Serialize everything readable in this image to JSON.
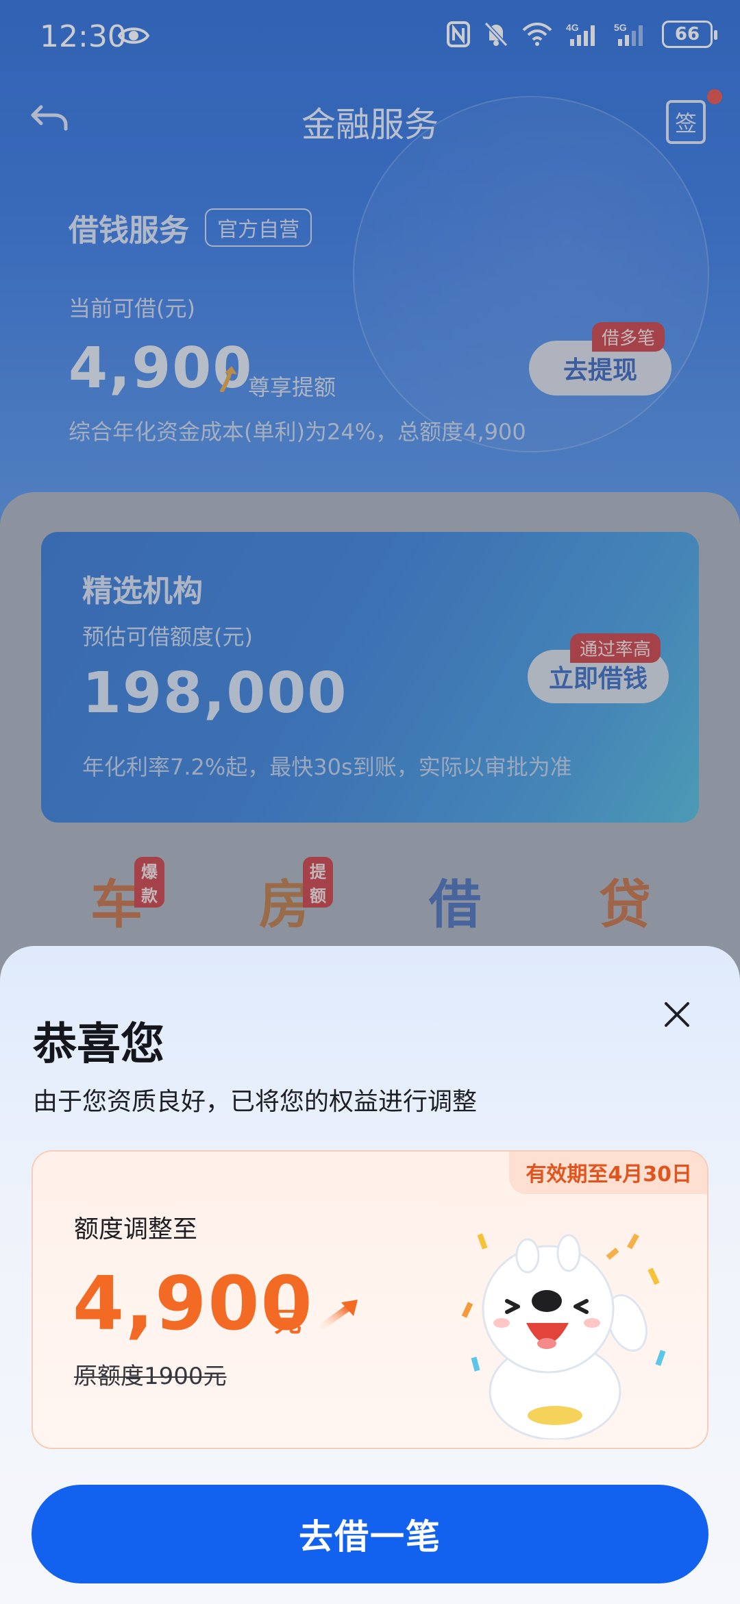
{
  "status_bar": {
    "time": "12:30",
    "battery": "66"
  },
  "nav": {
    "title": "金融服务",
    "sign_label": "签"
  },
  "loan": {
    "title": "借钱服务",
    "tag": "官方自营",
    "available_label": "当前可借(元)",
    "available_amount": "4,900",
    "enjoy_label": "尊享提额",
    "rate_note": "综合年化资金成本(单利)为24%，总额度4,900",
    "withdraw_button": "去提现",
    "withdraw_tag": "借多笔"
  },
  "selected_card": {
    "title": "精选机构",
    "label": "预估可借额度(元)",
    "amount": "198,000",
    "note": "年化利率7.2%起，最快30s到账，实际以审批为准",
    "button": "立即借钱",
    "button_tag": "通过率高"
  },
  "quick_entries": [
    {
      "label": "车",
      "tag": "爆款"
    },
    {
      "label": "房",
      "tag": "提额"
    },
    {
      "label": "借",
      "tag": ""
    },
    {
      "label": "贷",
      "tag": ""
    }
  ],
  "sheet": {
    "title": "恭喜您",
    "subtitle": "由于您资质良好，已将您的权益进行调整",
    "valid_tag": "有效期至4月30日",
    "offer_label": "额度调整至",
    "offer_amount": "4,900",
    "offer_unit": "元",
    "original_label": "原额度1900元",
    "cta": "去借一笔"
  },
  "colors": {
    "header_blue": "#2a6fe0",
    "cta_blue": "#1262ef",
    "accent_orange": "#f26a24",
    "tag_red": "#c8333a"
  },
  "icons": [
    "eye-icon",
    "nfc-icon",
    "mute-icon",
    "wifi-icon",
    "signal-4g-icon",
    "signal-5g-icon",
    "battery-icon",
    "back-icon",
    "sign-in-icon",
    "up-arrow-icon",
    "close-icon",
    "up-right-arrow-icon",
    "mascot-illustration"
  ]
}
